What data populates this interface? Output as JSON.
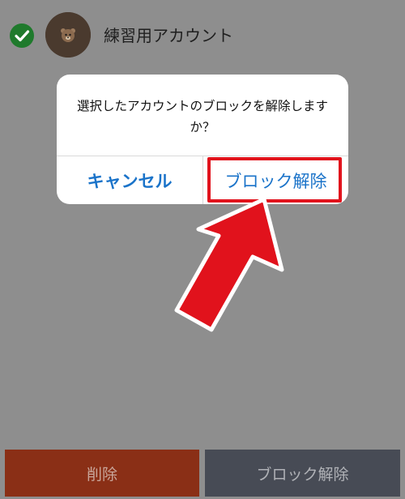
{
  "account_row": {
    "name": "練習用アカウント",
    "check_icon": "check-icon",
    "avatar_icon": "bear-avatar-icon"
  },
  "dialog": {
    "message": "選択したアカウントのブロックを解除しますか？",
    "cancel_label": "キャンセル",
    "unblock_label": "ブロック解除"
  },
  "bottom_bar": {
    "delete_label": "削除",
    "unblock_label": "ブロック解除"
  },
  "annotation": {
    "highlight_color": "#e1121c",
    "arrow_icon": "red-arrow-icon"
  },
  "colors": {
    "accent_blue": "#1a73c9",
    "delete_bg": "#8a2f16",
    "unblock_bg": "#474b55",
    "check_green": "#1f7a2c"
  }
}
